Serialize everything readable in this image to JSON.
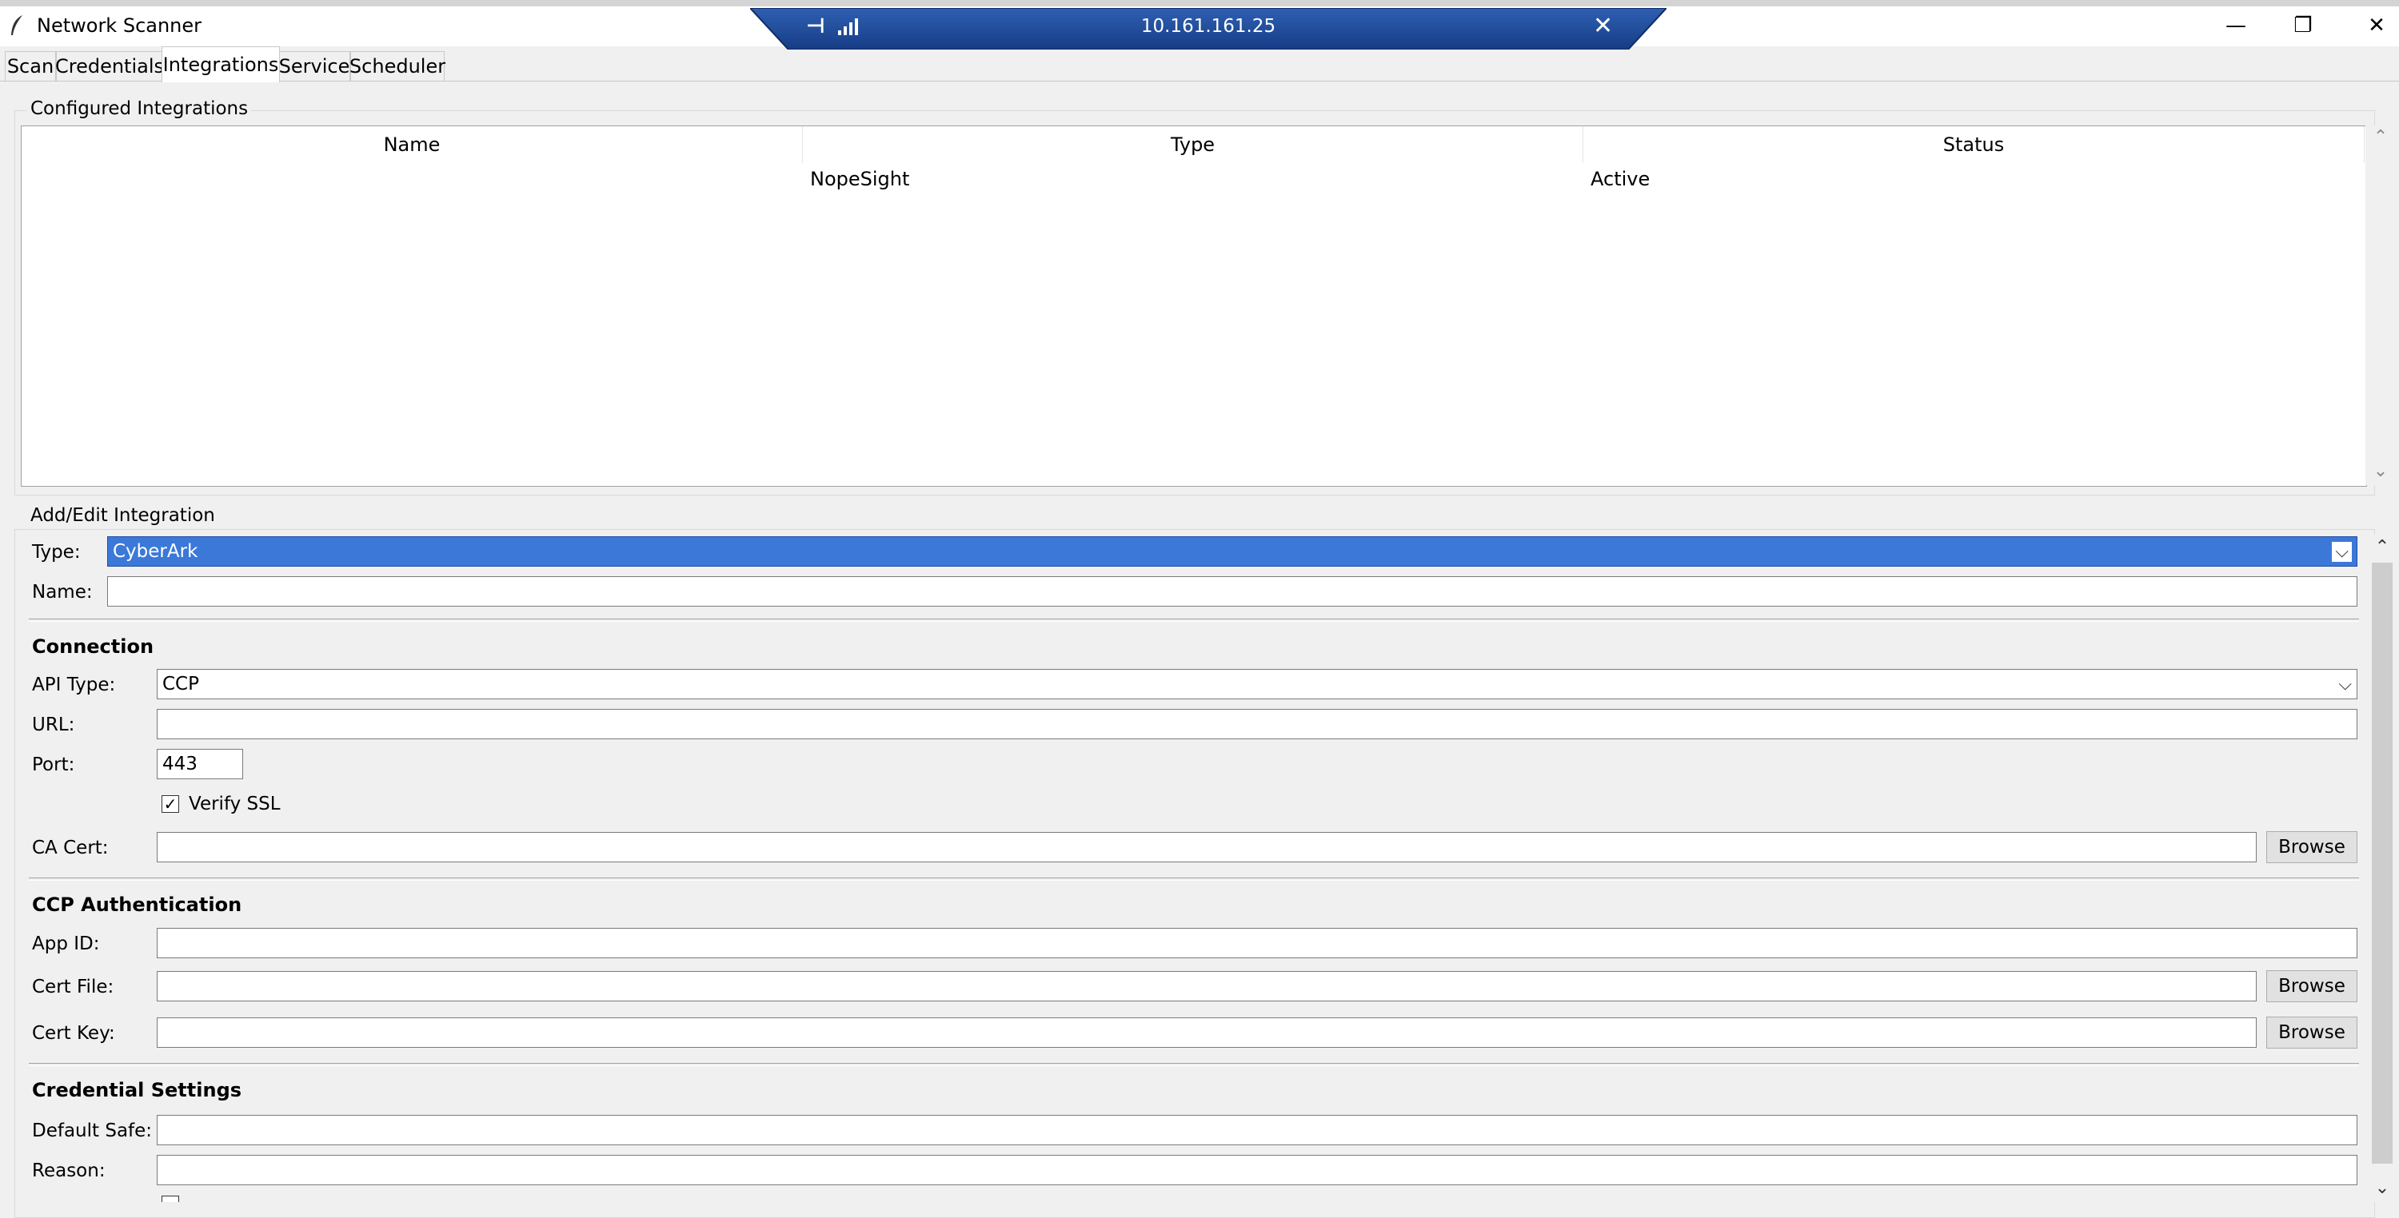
{
  "window": {
    "title": "Network Scanner",
    "minimize_glyph": "—",
    "restore_glyph": "❐",
    "close_glyph": "✕"
  },
  "rdp_bar": {
    "host": "10.161.161.25",
    "pin_glyph": "⊣",
    "close_glyph": "✕"
  },
  "tabs": [
    {
      "label": "Scan",
      "active": false
    },
    {
      "label": "Credentials",
      "active": false
    },
    {
      "label": "Integrations",
      "active": true
    },
    {
      "label": "Service",
      "active": false
    },
    {
      "label": "Scheduler",
      "active": false
    }
  ],
  "configured": {
    "group_label": "Configured Integrations",
    "columns": [
      "Name",
      "Type",
      "Status"
    ],
    "rows": [
      {
        "name": "",
        "type": "NopeSight",
        "status": "Active"
      }
    ]
  },
  "add_edit": {
    "group_label": "Add/Edit Integration",
    "type_label": "Type:",
    "type_value": "CyberArk",
    "name_label": "Name:",
    "name_value": ""
  },
  "connection": {
    "heading": "Connection",
    "api_type_label": "API Type:",
    "api_type_value": "CCP",
    "url_label": "URL:",
    "url_value": "",
    "port_label": "Port:",
    "port_value": "443",
    "verify_ssl_label": "Verify SSL",
    "verify_ssl_checked": true,
    "ca_cert_label": "CA Cert:",
    "ca_cert_value": "",
    "browse_label": "Browse"
  },
  "ccp_auth": {
    "heading": "CCP Authentication",
    "app_id_label": "App ID:",
    "cert_file_label": "Cert File:",
    "cert_key_label": "Cert Key:",
    "browse_label": "Browse"
  },
  "credential_settings": {
    "heading": "Credential Settings",
    "default_safe_label": "Default Safe:",
    "reason_label": "Reason:"
  },
  "icons": {
    "app": "feather-icon",
    "check": "✓",
    "dropdown": "⌵",
    "scroll_up": "⌃",
    "scroll_down": "⌄"
  },
  "colors": {
    "rdp_bar": "#1e4b9a",
    "selection": "#3b78d8",
    "window_bg": "#f0f0f0"
  }
}
